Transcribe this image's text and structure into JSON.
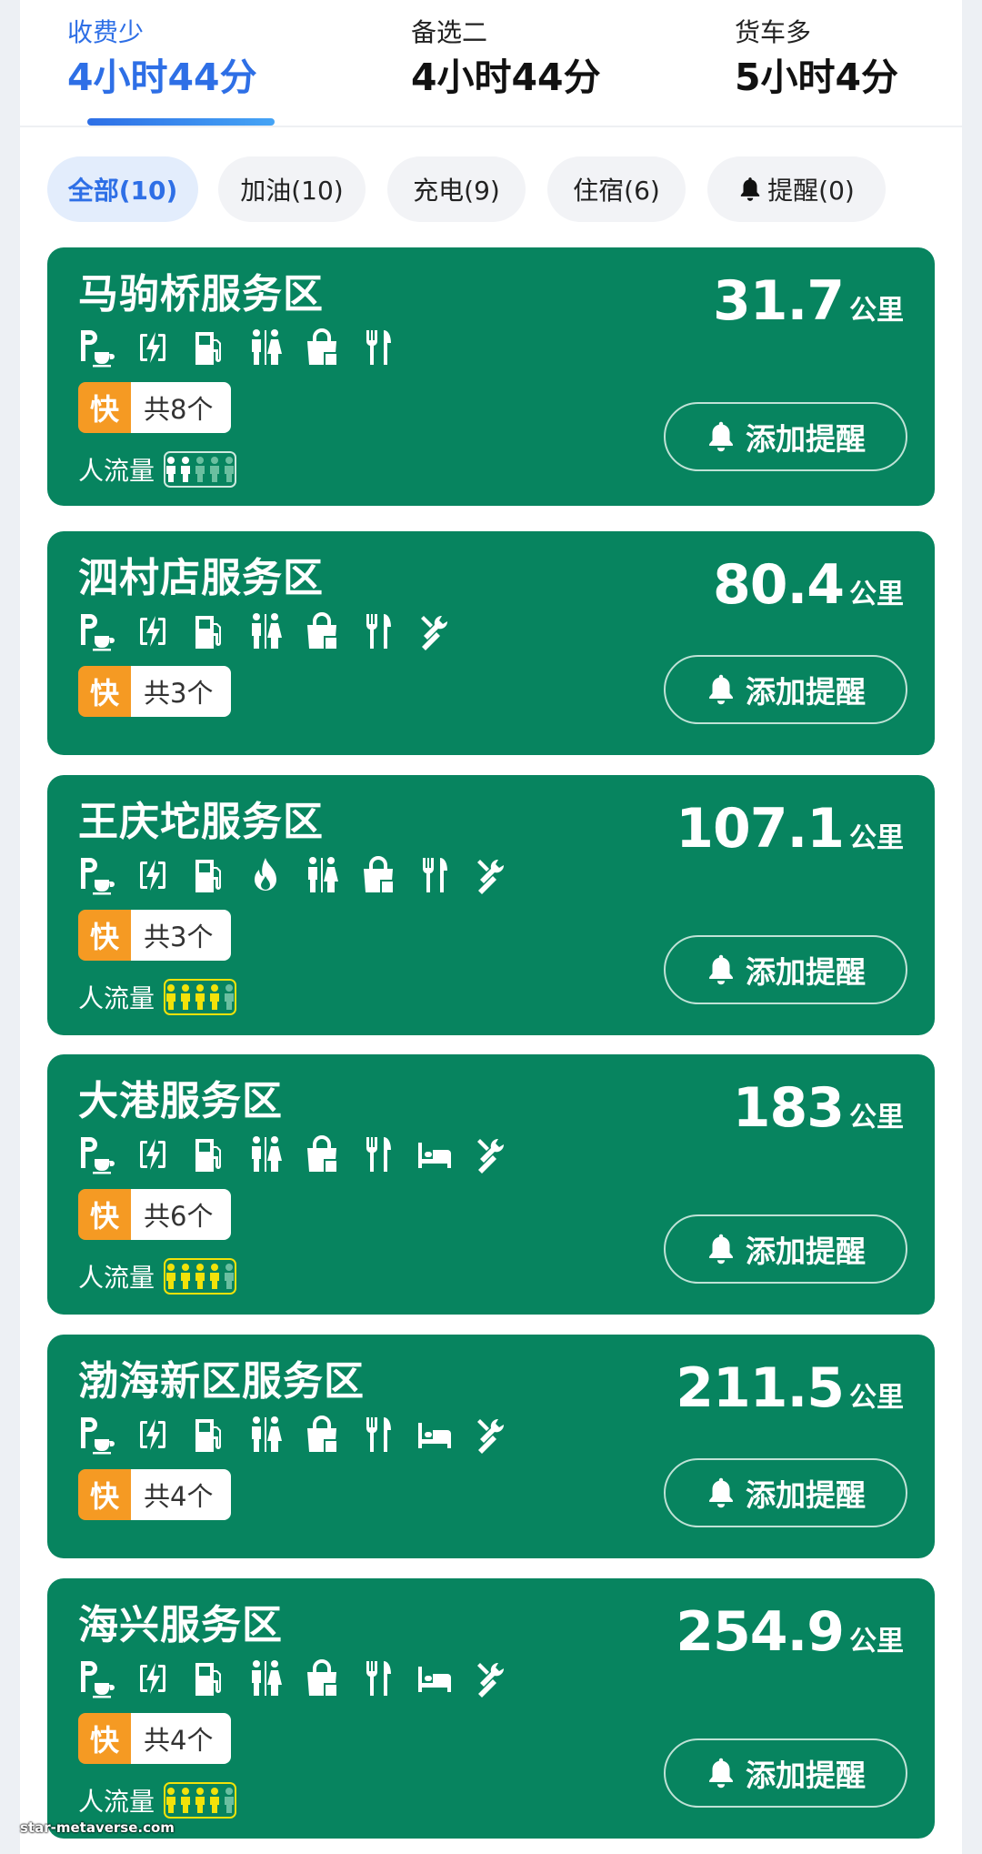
{
  "tabs": [
    {
      "label": "收费少",
      "time": "4小时44分",
      "active": true
    },
    {
      "label": "备选二",
      "time": "4小时44分",
      "active": false
    },
    {
      "label": "货车多",
      "time": "5小时4分",
      "active": false
    }
  ],
  "filters": [
    {
      "label": "全部(10)",
      "active": true
    },
    {
      "label": "加油(10)",
      "active": false
    },
    {
      "label": "充电(9)",
      "active": false
    },
    {
      "label": "住宿(6)",
      "active": false
    },
    {
      "label": "提醒(0)",
      "active": false,
      "icon": "bell-icon"
    }
  ],
  "cards": [
    {
      "name": "马驹桥服务区",
      "distance": "31.7",
      "unit": "公里",
      "fast_tag": "快",
      "fast_count": "共8个",
      "crowd_label": "人流量",
      "crowd_level": 2,
      "crowd_max": 5,
      "facilities": [
        "parking-cafe-icon",
        "charging-icon",
        "fuel-icon",
        "restroom-icon",
        "shop-icon",
        "restaurant-icon"
      ],
      "remind_label": "添加提醒"
    },
    {
      "name": "泗村店服务区",
      "distance": "80.4",
      "unit": "公里",
      "fast_tag": "快",
      "fast_count": "共3个",
      "crowd_label": null,
      "crowd_level": null,
      "crowd_max": 5,
      "facilities": [
        "parking-cafe-icon",
        "charging-icon",
        "fuel-icon",
        "restroom-icon",
        "shop-icon",
        "restaurant-icon",
        "repair-icon"
      ],
      "remind_label": "添加提醒"
    },
    {
      "name": "王庆坨服务区",
      "distance": "107.1",
      "unit": "公里",
      "fast_tag": "快",
      "fast_count": "共3个",
      "crowd_label": "人流量",
      "crowd_level": 4,
      "crowd_max": 5,
      "facilities": [
        "parking-cafe-icon",
        "charging-icon",
        "fuel-icon",
        "gas-flame-icon",
        "restroom-icon",
        "shop-icon",
        "restaurant-icon",
        "repair-icon"
      ],
      "remind_label": "添加提醒"
    },
    {
      "name": "大港服务区",
      "distance": "183",
      "unit": "公里",
      "fast_tag": "快",
      "fast_count": "共6个",
      "crowd_label": "人流量",
      "crowd_level": 4,
      "crowd_max": 5,
      "facilities": [
        "parking-cafe-icon",
        "charging-icon",
        "fuel-icon",
        "restroom-icon",
        "shop-icon",
        "restaurant-icon",
        "hotel-bed-icon",
        "repair-icon"
      ],
      "remind_label": "添加提醒"
    },
    {
      "name": "渤海新区服务区",
      "distance": "211.5",
      "unit": "公里",
      "fast_tag": "快",
      "fast_count": "共4个",
      "crowd_label": null,
      "crowd_level": null,
      "crowd_max": 5,
      "facilities": [
        "parking-cafe-icon",
        "charging-icon",
        "fuel-icon",
        "restroom-icon",
        "shop-icon",
        "restaurant-icon",
        "hotel-bed-icon",
        "repair-icon"
      ],
      "remind_label": "添加提醒"
    },
    {
      "name": "海兴服务区",
      "distance": "254.9",
      "unit": "公里",
      "fast_tag": "快",
      "fast_count": "共4个",
      "crowd_label": "人流量",
      "crowd_level": 4,
      "crowd_max": 5,
      "facilities": [
        "parking-cafe-icon",
        "charging-icon",
        "fuel-icon",
        "restroom-icon",
        "shop-icon",
        "restaurant-icon",
        "hotel-bed-icon",
        "repair-icon"
      ],
      "remind_label": "添加提醒"
    }
  ],
  "colors": {
    "accent": "#2e6fe6",
    "card": "#07845f",
    "fast_tag": "#f59a23",
    "crowd_high": "#f2e20a",
    "crowd_low": "#ffffff",
    "crowd_inactive": "#6bbfa0"
  },
  "watermark": "star-metaverse.com"
}
